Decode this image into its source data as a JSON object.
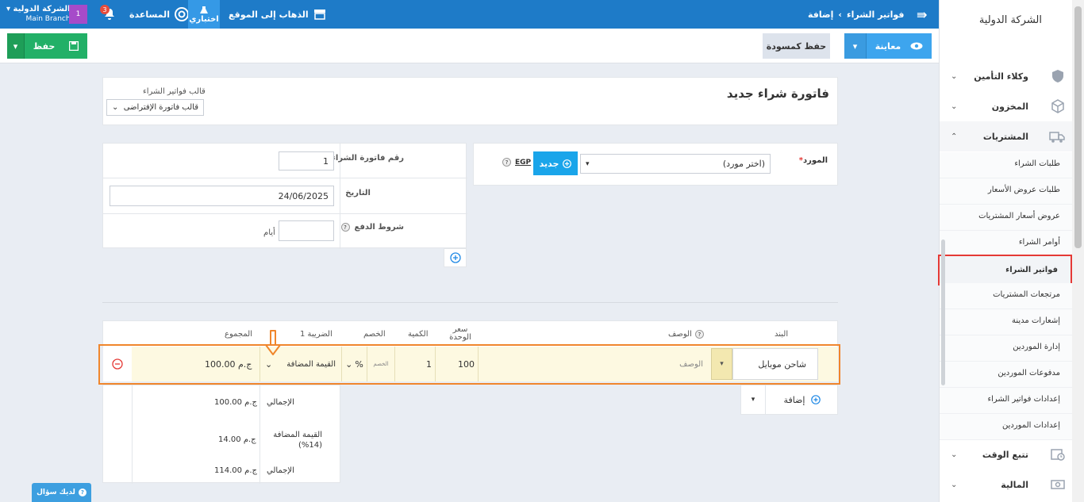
{
  "topbar": {
    "company_name": "الشركة الدولية",
    "branch": "Main Branch",
    "badge": "1",
    "notifications": "3",
    "help": "المساعدة",
    "test": "اختباري",
    "go_to_site": "الذهاب إلى الموقع",
    "breadcrumb_section": "فواتير الشراء",
    "breadcrumb_current": "إضافة",
    "accent": "#1e7bc8"
  },
  "toolbar": {
    "save": "حفظ",
    "save_draft": "حفظ كمسودة",
    "preview": "معاينة"
  },
  "header": {
    "title": "فاتورة شراء جديد",
    "template_label": "قالب فواتير الشراء",
    "template_value": "قالب فاتورة الإفتراضى"
  },
  "invoice": {
    "number_label": "رقم فاتورة الشراء",
    "number_value": "1",
    "date_label": "التاريخ",
    "date_value": "24/06/2025",
    "terms_label": "شروط الدفع",
    "terms_unit": "أيام"
  },
  "supplier": {
    "label": "المورد",
    "required": "*",
    "placeholder": "(اختر مورد)",
    "new_btn": "جديد",
    "currency": "EGP"
  },
  "table": {
    "headers": {
      "item": "البند",
      "description": "الوصف",
      "unit_price": "سعر الوحدة",
      "quantity": "الكمية",
      "discount": "الخصم",
      "tax1": "الضريبة 1",
      "total": "المجموع"
    },
    "row": {
      "item": "شاحن موبايل",
      "description_placeholder": "الوصف",
      "unit_price": "100",
      "quantity": "1",
      "discount_placeholder": "الخصم",
      "discount_type": "%",
      "tax": "القيمة المضافة",
      "total": "100.00 ج.م"
    },
    "add_btn": "إضافة"
  },
  "totals": {
    "subtotal_label": "الإجمالي",
    "subtotal_value": "100.00 ج.م",
    "vat_label": "القيمة المضافة (14%)",
    "vat_value": "14.00 ج.م",
    "total_label": "الإجمالي",
    "total_value": "114.00 ج.م"
  },
  "sidebar": {
    "company": "الشركة الدولية",
    "menus": [
      {
        "label": "وكلاء التأمين"
      },
      {
        "label": "المخزون"
      },
      {
        "label": "المشتريات"
      }
    ],
    "sub_items": [
      "طلبات الشراء",
      "طلبات عروض الأسعار",
      "عروض أسعار المشتريات",
      "أوامر الشراء",
      "فواتير الشراء",
      "مرتجعات المشتريات",
      "إشعارات مدينة",
      "إدارة الموردين",
      "مدفوعات الموردين",
      "إعدادات فواتير الشراء",
      "إعدادات الموردين"
    ],
    "bottom_menus": [
      {
        "label": "تتبع الوقت"
      },
      {
        "label": "المالية"
      }
    ]
  },
  "help_widget": "لديك سؤال"
}
